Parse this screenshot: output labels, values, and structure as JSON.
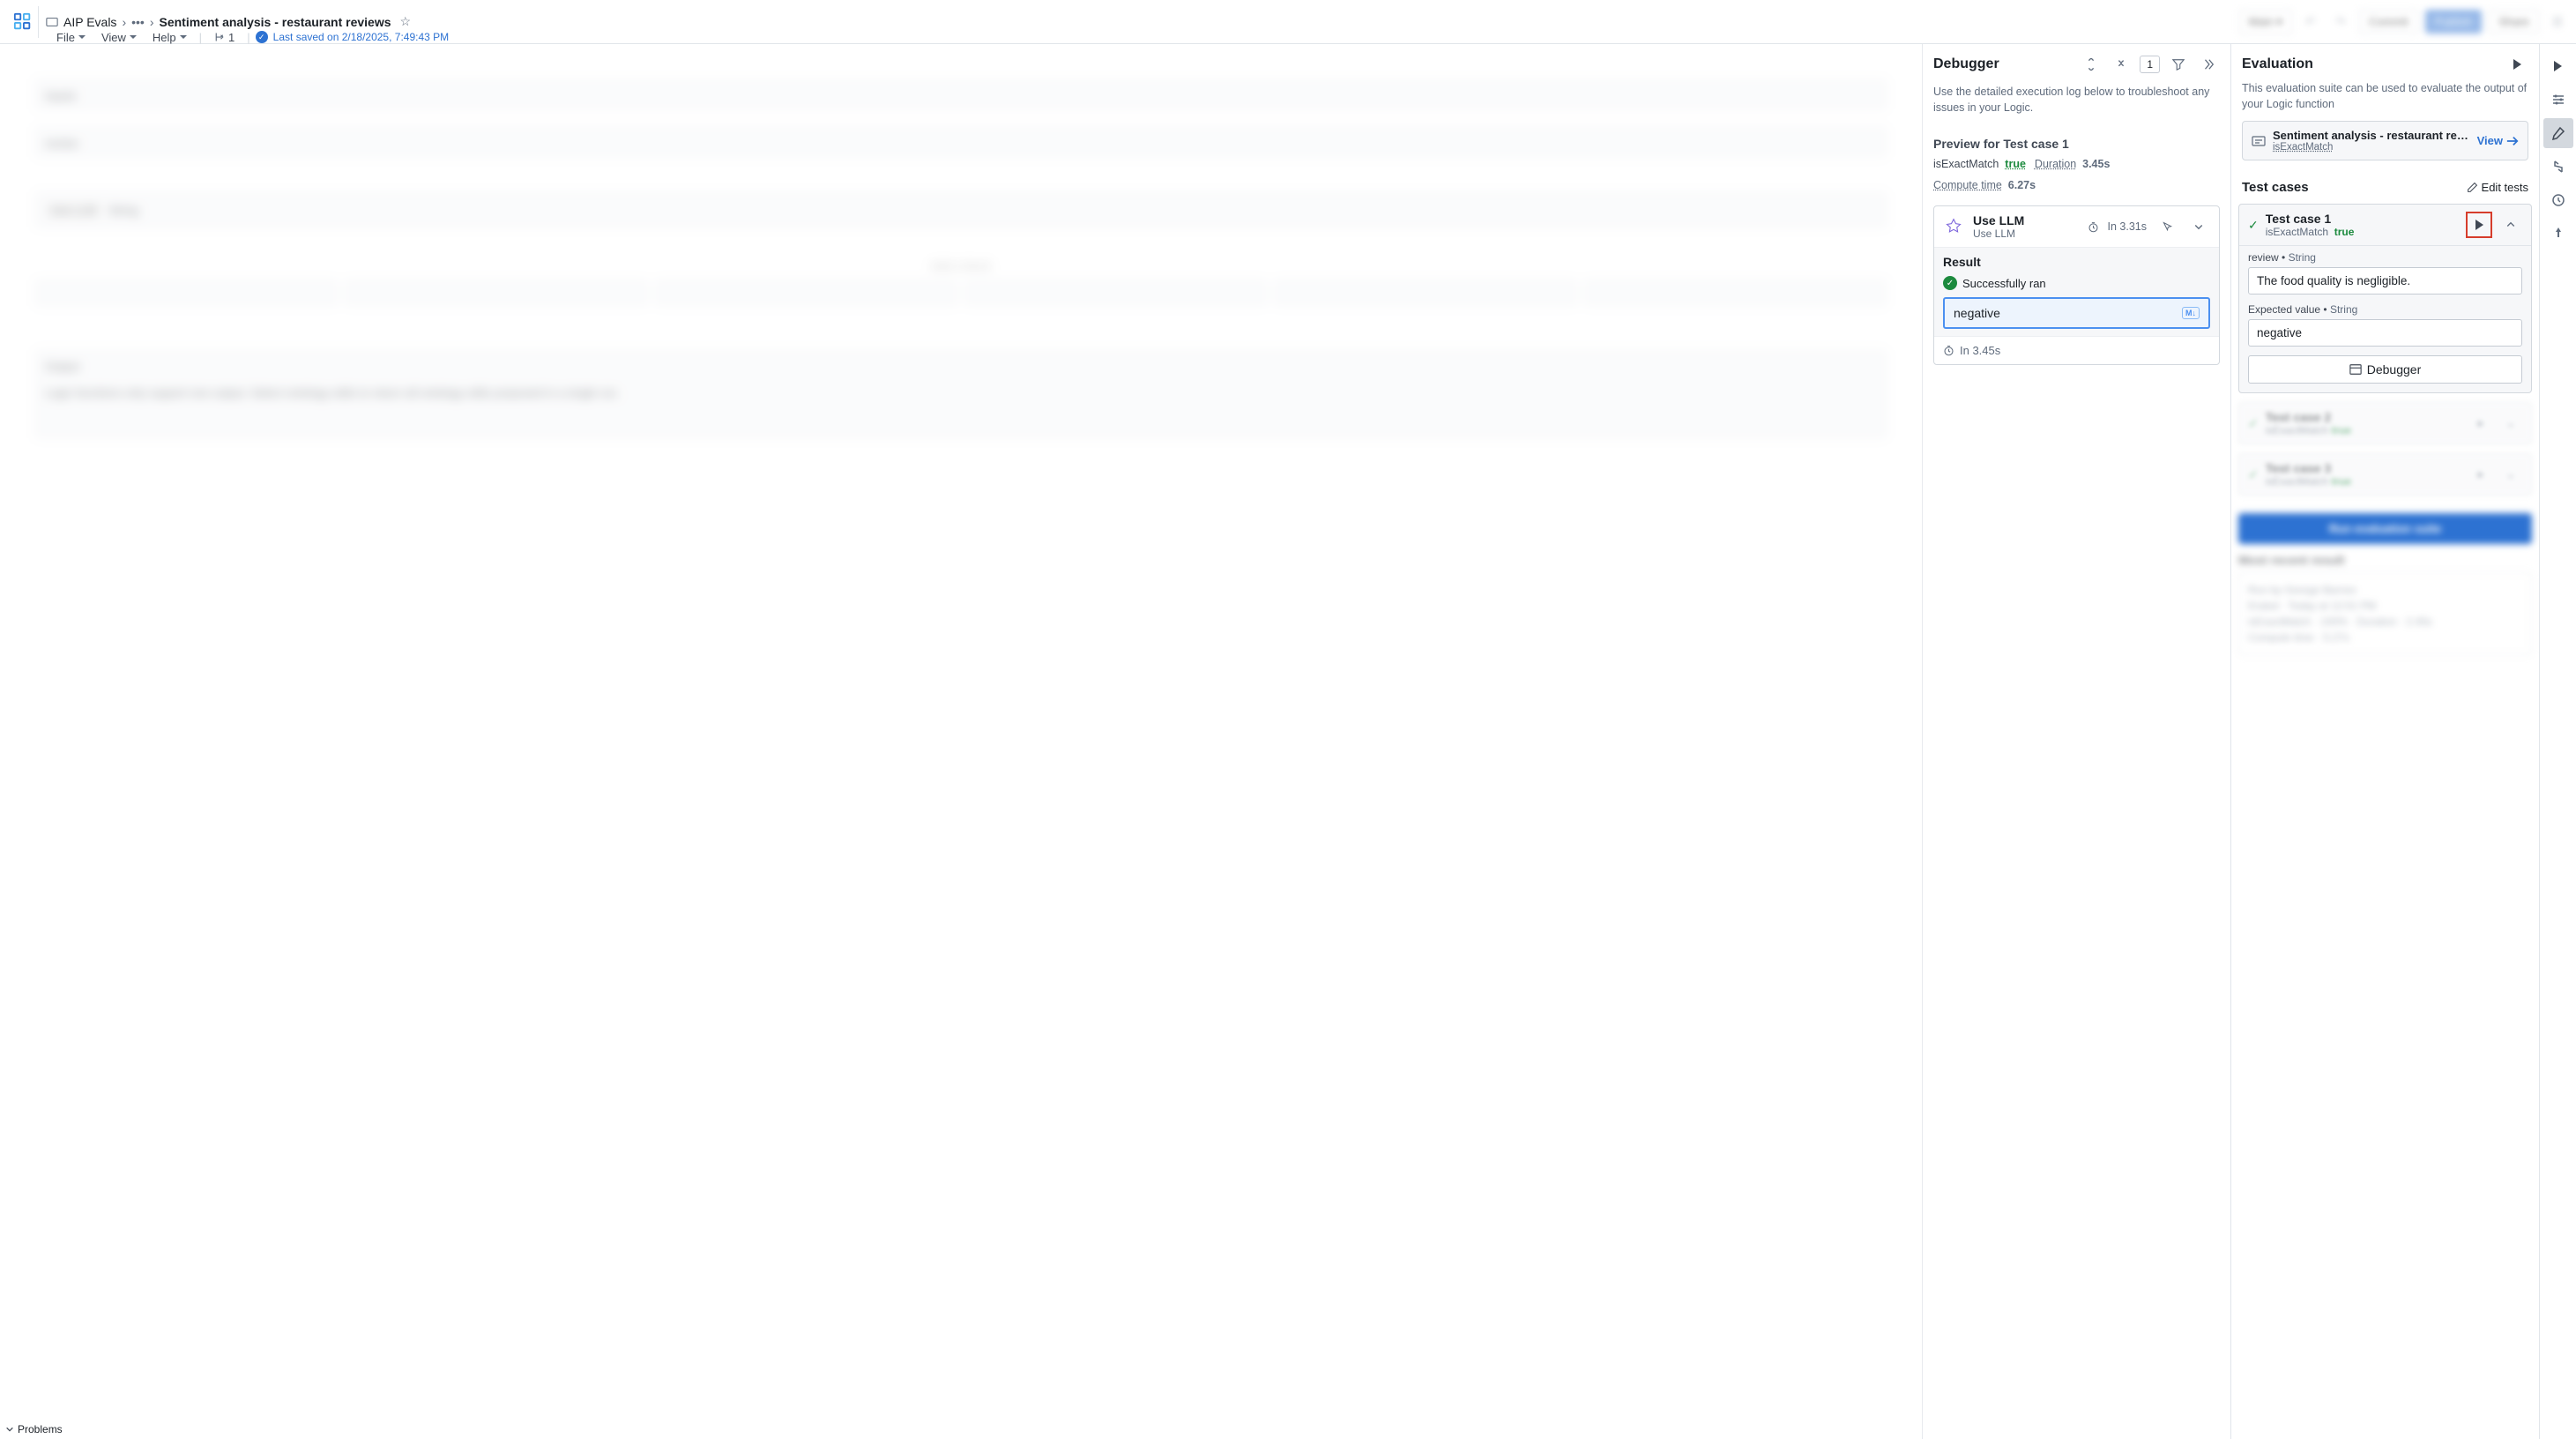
{
  "breadcrumb": {
    "app": "AIP Evals",
    "title": "Sentiment analysis - restaurant reviews"
  },
  "menubar": {
    "file": "File",
    "view": "View",
    "help": "Help",
    "branch_count": "1",
    "saved": "Last saved on 2/18/2025, 7:49:43 PM"
  },
  "topbar_right": {
    "main": "Main",
    "commit": "Commit",
    "publish": "Publish",
    "share": "Share"
  },
  "debugger": {
    "title": "Debugger",
    "count": "1",
    "description": "Use the detailed execution log below to troubleshoot any issues in your Logic.",
    "preview_title": "Preview for Test case 1",
    "metrics": {
      "col1_label": "isExactMatch",
      "col1_value": "true",
      "duration_label": "Duration",
      "duration_value": "3.45s",
      "compute_label": "Compute time",
      "compute_value": "6.27s"
    },
    "llm_card": {
      "title": "Use LLM",
      "sub": "Use LLM",
      "time": "In 3.31s"
    },
    "result": {
      "label": "Result",
      "success": "Successfully ran",
      "value": "negative",
      "footer": "In 3.45s"
    }
  },
  "evaluation": {
    "title": "Evaluation",
    "description": "This evaluation suite can be used to evaluate the output of your Logic function",
    "suite_name": "Sentiment analysis - restaurant revi…",
    "suite_sub": "isExactMatch",
    "view": "View",
    "testcases_label": "Test cases",
    "edit_tests": "Edit tests",
    "tc1": {
      "title": "Test case 1",
      "metric": "isExactMatch",
      "value": "true",
      "review_label": "review",
      "review_type": "String",
      "review_value": "The food quality is negligible.",
      "expected_label": "Expected value",
      "expected_type": "String",
      "expected_value": "negative",
      "debugger_btn": "Debugger"
    },
    "tc2": {
      "title": "Test case 2",
      "metric": "isExactMatch",
      "value": "true"
    },
    "tc3": {
      "title": "Test case 3",
      "metric": "isExactMatch",
      "value": "true"
    },
    "run_suite": "Run evaluation suite",
    "recent_title": "Most recent result",
    "recent_run_by": "Run by George Barnes",
    "recent_line2": "Ended · Today at 12:01 PM",
    "recent_line3": "isExactMatch · 100% · Duration · 2.45s",
    "recent_line4": "Compute time · 5.27s"
  },
  "problems": "Problems"
}
